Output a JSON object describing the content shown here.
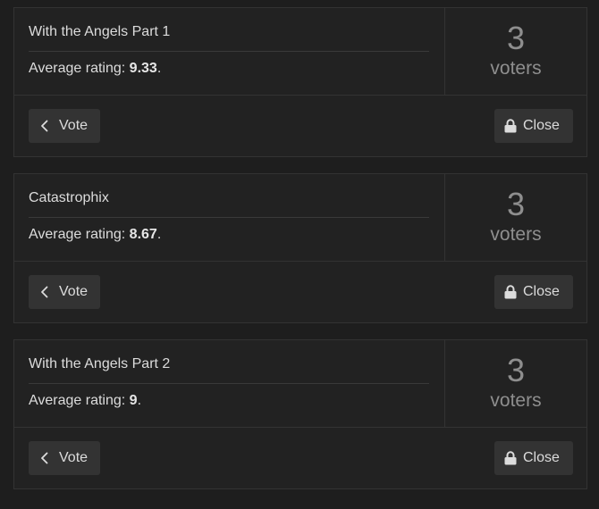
{
  "polls": [
    {
      "title": "With the Angels Part 1",
      "rating_prefix": "Average rating: ",
      "rating": "9.33",
      "rating_suffix": ".",
      "voter_count": "3",
      "voter_label": "voters",
      "vote_label": "Vote",
      "close_label": "Close"
    },
    {
      "title": "Catastrophix",
      "rating_prefix": "Average rating: ",
      "rating": "8.67",
      "rating_suffix": ".",
      "voter_count": "3",
      "voter_label": "voters",
      "vote_label": "Vote",
      "close_label": "Close"
    },
    {
      "title": "With the Angels Part 2",
      "rating_prefix": "Average rating: ",
      "rating": "9",
      "rating_suffix": ".",
      "voter_count": "3",
      "voter_label": "voters",
      "vote_label": "Vote",
      "close_label": "Close"
    }
  ],
  "icons": {
    "vote": "chevron-left-icon",
    "close": "lock-icon"
  },
  "colors": {
    "background": "#1e1e1e",
    "card": "#222222",
    "border": "#333333",
    "button": "#333333",
    "text": "#dcdcdc",
    "muted": "#8e8e8e"
  }
}
